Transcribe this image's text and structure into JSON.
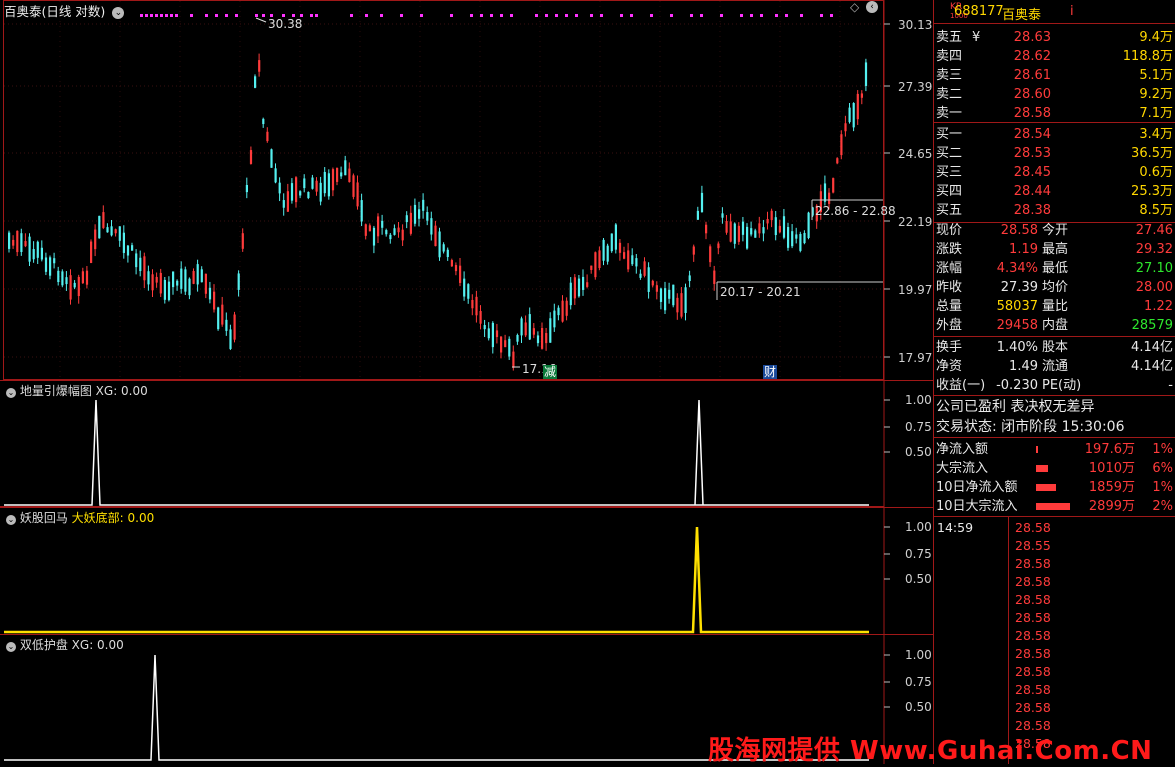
{
  "title": "百奥泰(日线 对数)",
  "main_chart": {
    "price_ticks": [
      "30.13",
      "27.39",
      "24.65",
      "22.19",
      "19.97",
      "17.97"
    ],
    "high_annotation": "30.38",
    "low_annotation": "17.16",
    "range_box_1": "22.86 - 22.88",
    "range_box_2": "20.17 - 20.21",
    "event_tag_1": "减",
    "event_tag_2": "财"
  },
  "panels": [
    {
      "name": "地量引爆幅图",
      "label2": "XG: 0.00",
      "ticks": [
        "1.00",
        "0.75",
        "0.50"
      ]
    },
    {
      "name": "妖股回马",
      "label2": "大妖底部: 0.00",
      "ticks": [
        "1.00",
        "0.75",
        "0.50"
      ]
    },
    {
      "name": "双低护盘",
      "label2": "XG: 0.00",
      "ticks": [
        "1.00",
        "0.75",
        "0.50"
      ]
    }
  ],
  "stock": {
    "badge_top": "KR",
    "badge_bottom": "1000",
    "code": "688177",
    "name": "百奥泰",
    "info_icon": "i"
  },
  "sell_orders": [
    {
      "label": "卖五",
      "mark": "¥",
      "price": "28.63",
      "vol": "9.4万"
    },
    {
      "label": "卖四",
      "mark": "",
      "price": "28.62",
      "vol": "118.8万"
    },
    {
      "label": "卖三",
      "mark": "",
      "price": "28.61",
      "vol": "5.1万"
    },
    {
      "label": "卖二",
      "mark": "",
      "price": "28.60",
      "vol": "9.2万"
    },
    {
      "label": "卖一",
      "mark": "",
      "price": "28.58",
      "vol": "7.1万"
    }
  ],
  "buy_orders": [
    {
      "label": "买一",
      "price": "28.54",
      "vol": "3.4万"
    },
    {
      "label": "买二",
      "price": "28.53",
      "vol": "36.5万"
    },
    {
      "label": "买三",
      "price": "28.45",
      "vol": "0.6万"
    },
    {
      "label": "买四",
      "price": "28.44",
      "vol": "25.3万"
    },
    {
      "label": "买五",
      "price": "28.38",
      "vol": "8.5万"
    }
  ],
  "quote": [
    {
      "l1": "现价",
      "v1": "28.58",
      "c1": "red",
      "l2": "今开",
      "v2": "27.46",
      "c2": "red"
    },
    {
      "l1": "涨跌",
      "v1": "1.19",
      "c1": "red",
      "l2": "最高",
      "v2": "29.32",
      "c2": "red"
    },
    {
      "l1": "涨幅",
      "v1": "4.34%",
      "c1": "red",
      "l2": "最低",
      "v2": "27.10",
      "c2": "green"
    },
    {
      "l1": "昨收",
      "v1": "27.39",
      "c1": "white",
      "l2": "均价",
      "v2": "28.00",
      "c2": "red"
    },
    {
      "l1": "总量",
      "v1": "58037",
      "c1": "yellow",
      "l2": "量比",
      "v2": "1.22",
      "c2": "red"
    },
    {
      "l1": "外盘",
      "v1": "29458",
      "c1": "red",
      "l2": "内盘",
      "v2": "28579",
      "c2": "green"
    }
  ],
  "fundamentals": [
    {
      "l1": "换手",
      "v1": "1.40%",
      "l2": "股本",
      "v2": "4.14亿"
    },
    {
      "l1": "净资",
      "v1": "1.49",
      "l2": "流通",
      "v2": "4.14亿"
    },
    {
      "l1": "收益(一)",
      "v1": "-0.230",
      "l2": "PE(动)",
      "v2": "-"
    }
  ],
  "company_status": "公司已盈利 表决权无差异",
  "trade_status": "交易状态: 闭市阶段 15:30:06",
  "flows": [
    {
      "label": "净流入额",
      "value": "197.6万",
      "pct": "1%",
      "level": 0.03
    },
    {
      "label": "大宗流入",
      "value": "1010万",
      "pct": "6%",
      "level": 0.35
    },
    {
      "label": "10日净流入额",
      "value": "1859万",
      "pct": "1%",
      "level": 0.6
    },
    {
      "label": "10日大宗流入",
      "value": "2899万",
      "pct": "2%",
      "level": 1.0
    }
  ],
  "ticks_time": "14:59",
  "tick_prices": [
    "28.58",
    "28.55",
    "28.58",
    "28.58",
    "28.58",
    "28.58",
    "28.58",
    "28.58",
    "28.58",
    "28.58",
    "28.58",
    "28.58",
    "28.58"
  ],
  "watermark": "股海网提供 Www.Guhai.Com.CN",
  "colors": {
    "up": "#ff3b3b",
    "down": "#54f0f0",
    "border": "#a01818",
    "flag": "#ff33ff"
  }
}
